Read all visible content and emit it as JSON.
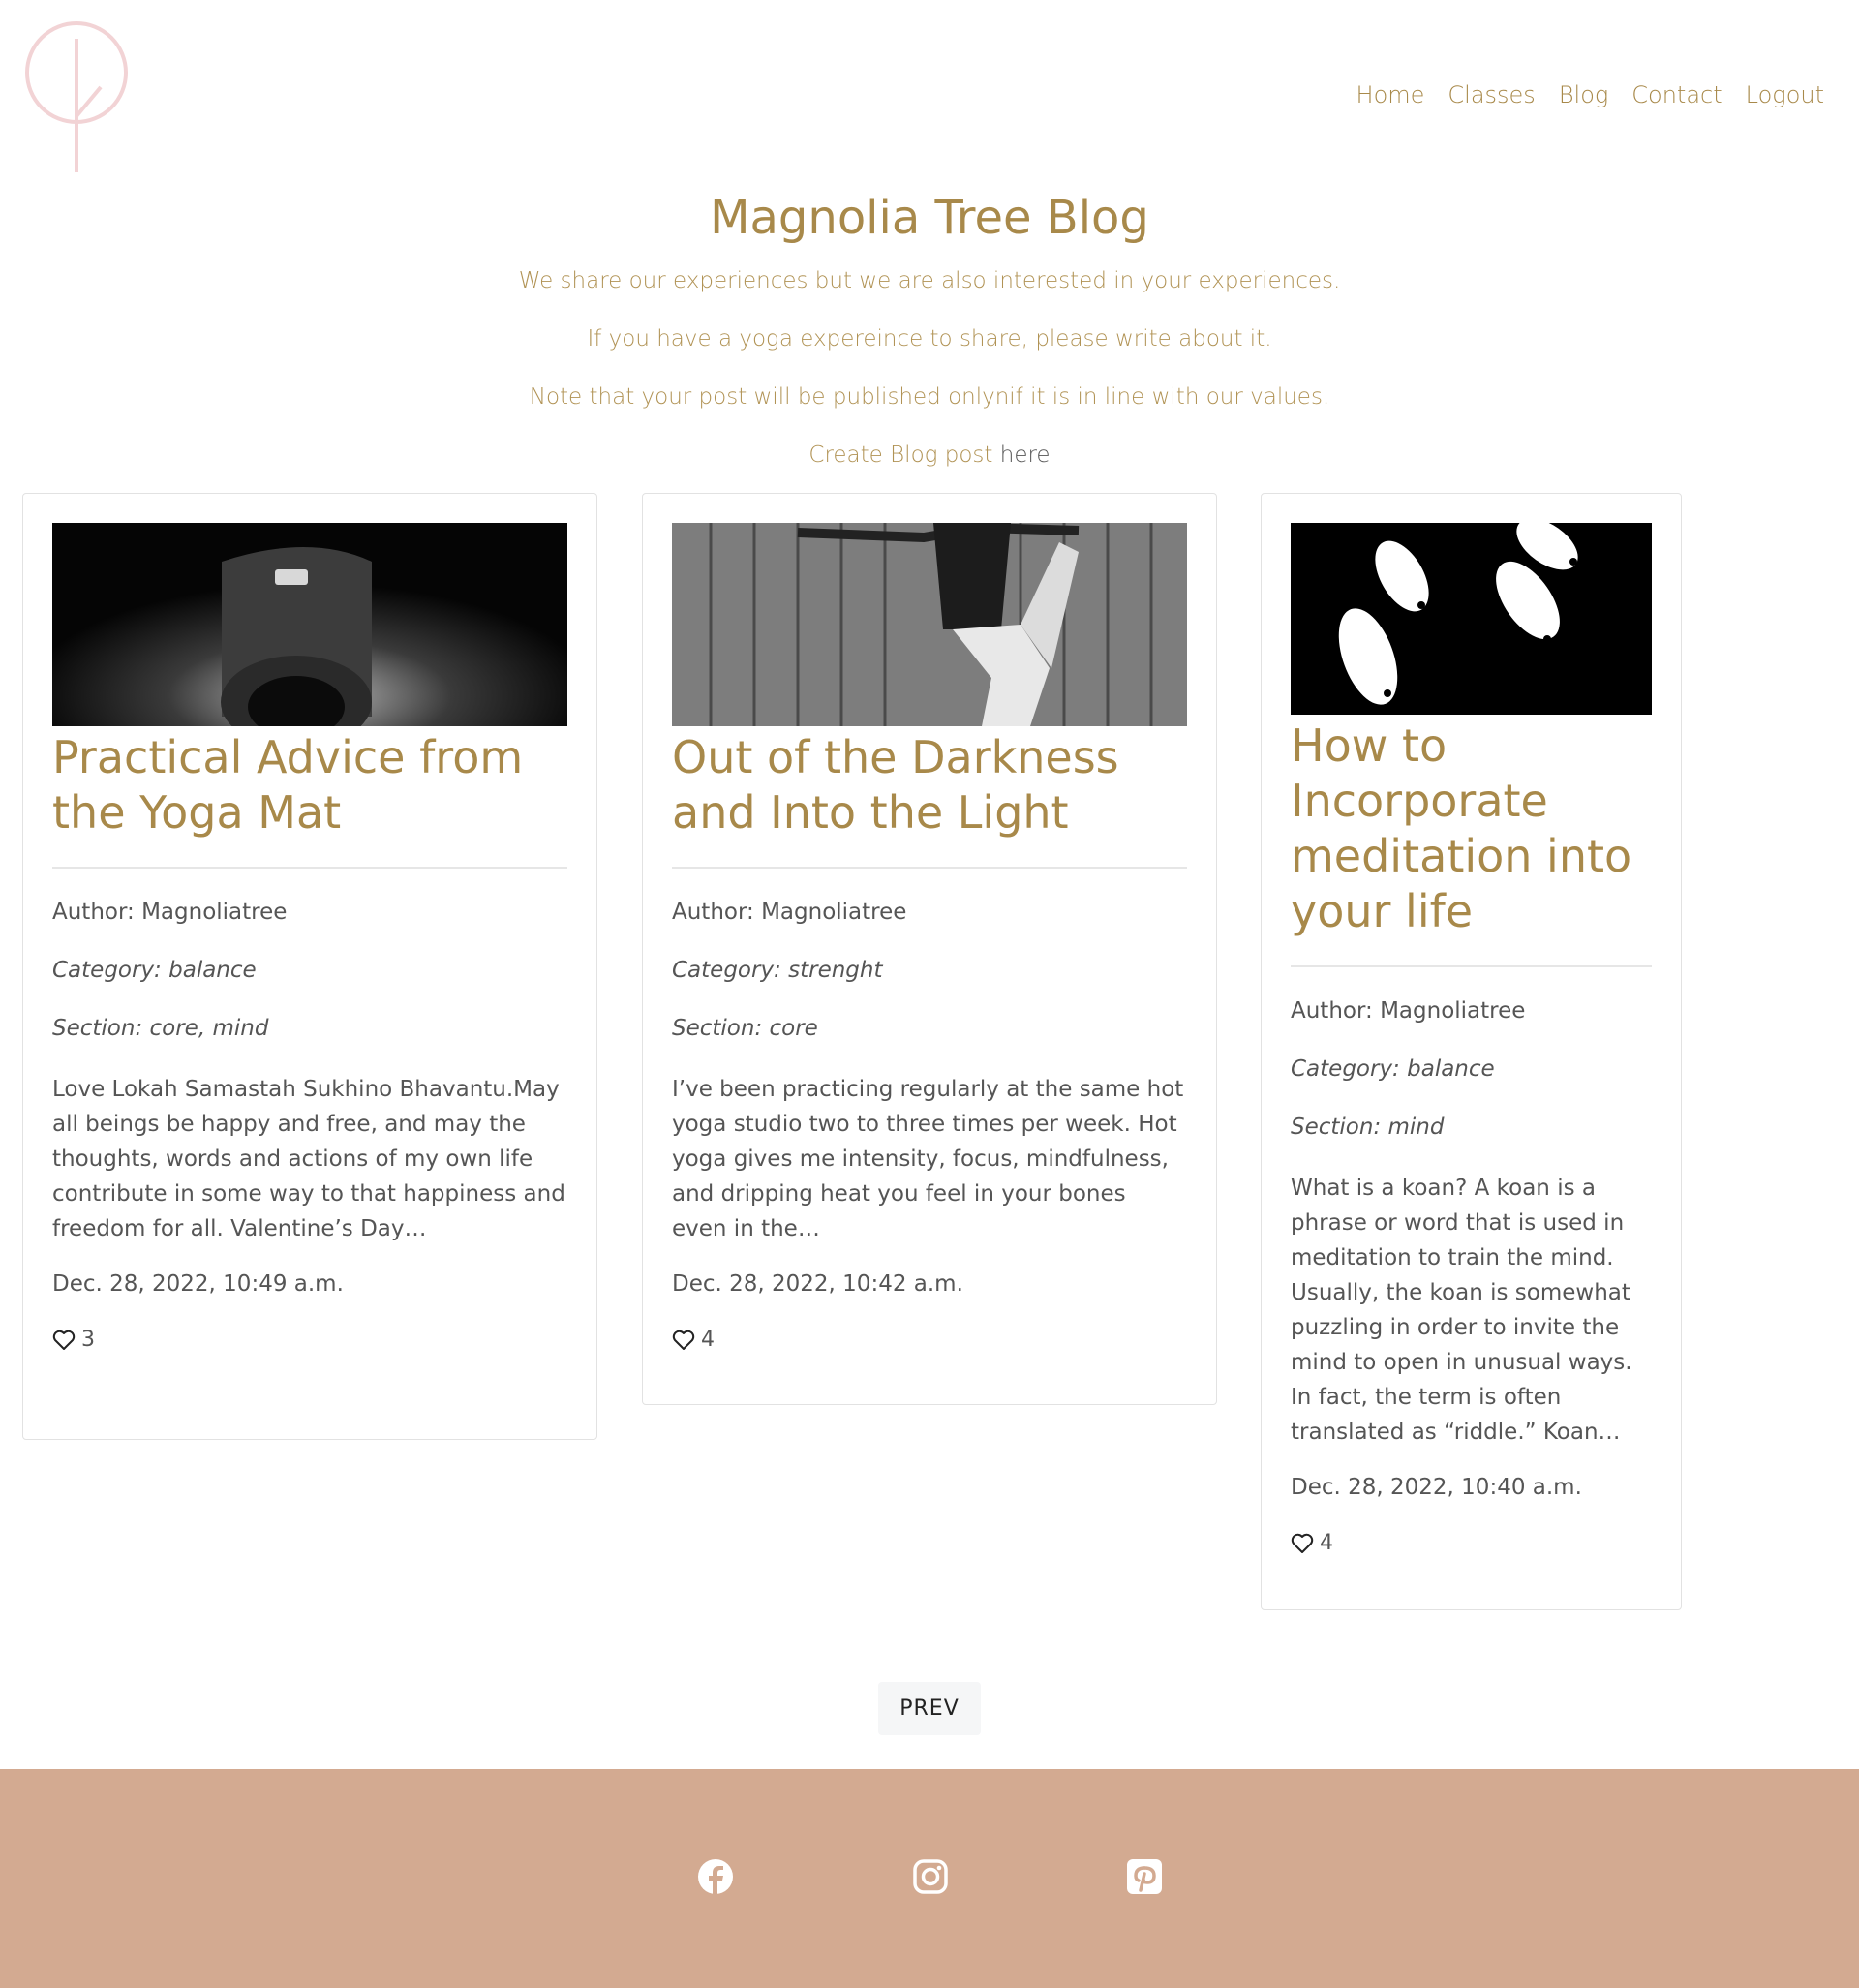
{
  "nav": {
    "items": [
      {
        "label": "Home"
      },
      {
        "label": "Classes"
      },
      {
        "label": "Blog"
      },
      {
        "label": "Contact"
      },
      {
        "label": "Logout"
      }
    ]
  },
  "intro": {
    "title": "Magnolia Tree Blog",
    "lines": [
      "We share our experiences but we are also interested in your experiences.",
      "If you have a yoga expereince to share, please write about it.",
      "Note that your post will be published onlynif it is in line with our values."
    ],
    "create_text": "Create Blog post",
    "create_link": "here"
  },
  "posts": [
    {
      "title": "Practical Advice from the Yoga Mat",
      "author": "Author: Magnoliatree",
      "category": "Category: balance",
      "section": "Section: core, mind",
      "excerpt": "Love Lokah Samastah Sukhino Bhavantu.May all beings be happy and free, and may the thoughts, words and actions of my own life contribute in some way to that happiness and freedom for all. Valentine’s Day…",
      "date": "Dec. 28, 2022, 10:49 a.m.",
      "likes": "3",
      "image": "rolled-yoga-mat-photo"
    },
    {
      "title": "Out of the Darkness and Into the Light",
      "author": "Author: Magnoliatree",
      "category": "Category: strenght",
      "section": "Section: core",
      "excerpt": "I’ve been practicing regularly at the same hot yoga studio two to three times per week. Hot yoga gives me intensity, focus, mindfulness, and dripping heat you feel in your bones even in the…",
      "date": "Dec. 28, 2022, 10:42 a.m.",
      "likes": "4",
      "image": "yoga-pose-photo"
    },
    {
      "title": "How to Incorporate meditation into your life",
      "author": "Author: Magnoliatree",
      "category": "Category: balance",
      "section": "Section: mind",
      "excerpt": "What is a koan? A koan is a phrase or word that is used in meditation to train the mind. Usually, the koan is somewhat puzzling in order to invite the mind to open in unusual ways. In fact, the term is often translated as “riddle.” Koan…",
      "date": "Dec. 28, 2022, 10:40 a.m.",
      "likes": "4",
      "image": "koi-fish-illustration"
    }
  ],
  "pagination": {
    "prev_label": "PREV"
  },
  "footer": {
    "icons": [
      "facebook-icon",
      "instagram-icon",
      "pinterest-icon"
    ]
  },
  "colors": {
    "accent": "#a8894a",
    "footer": "#d3aa91",
    "logo": "#f2d3d5"
  }
}
